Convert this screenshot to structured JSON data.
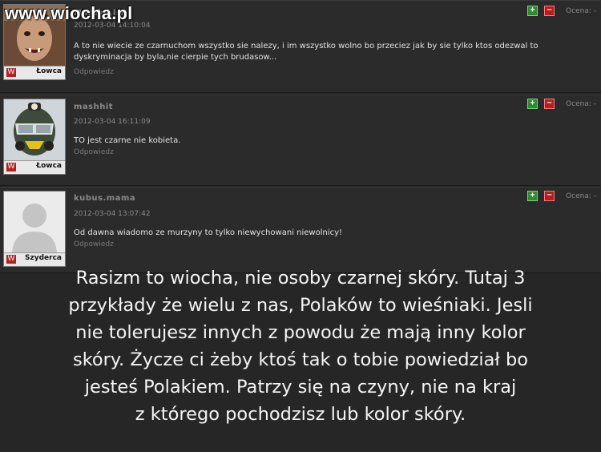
{
  "watermark": "www.wiocha.pl",
  "comments": [
    {
      "author": "Marekk.irl",
      "date": "2012-03-04 14:10:04",
      "text_line1": "A to nie wiecie ze czarnuchom wszystko sie nalezy, i im wszystko wolno bo przeciez jak by sie tylko ktos odezwal to",
      "text_line2": "dyskryminacja by byla,nie cierpie tych brudasow...",
      "reply": "Odpowiedz",
      "rank": "Łowca",
      "vote_label": "Ocena: -"
    },
    {
      "author": "mashhit",
      "date": "2012-03-04 16:11:09",
      "text_line1": "TO jest czarne nie kobieta.",
      "text_line2": "",
      "reply": "Odpowiedz",
      "rank": "Łowca",
      "vote_label": "Ocena: -"
    },
    {
      "author": "kubus.mama",
      "date": "2012-03-04 13:07:42",
      "text_line1": "Od dawna wiadomo ze murzyny to tylko niewychowani niewolnicy!",
      "text_line2": "",
      "reply": "Odpowiedz",
      "rank": "Szyderca",
      "vote_label": "Ocena: -"
    }
  ],
  "vote_plus": "+",
  "vote_minus": "−",
  "rank_icon": "W",
  "caption_lines": [
    "Rasizm to wiocha, nie osoby czarnej skóry. Tutaj 3",
    "przykłady że wielu z nas, Polaków to wieśniaki. Jesli",
    "nie tolerujesz innych z powodu że mają inny kolor",
    "skóry. Życze ci żeby ktoś tak o tobie powiedział bo",
    "jesteś Polakiem. Patrzy się na czyny, nie na kraj",
    "z którego pochodzisz lub kolor skóry."
  ],
  "colors": {
    "background": "#262626",
    "panel": "#2b2b2b",
    "plus": "#2e8b2e",
    "minus": "#b81c1c"
  }
}
